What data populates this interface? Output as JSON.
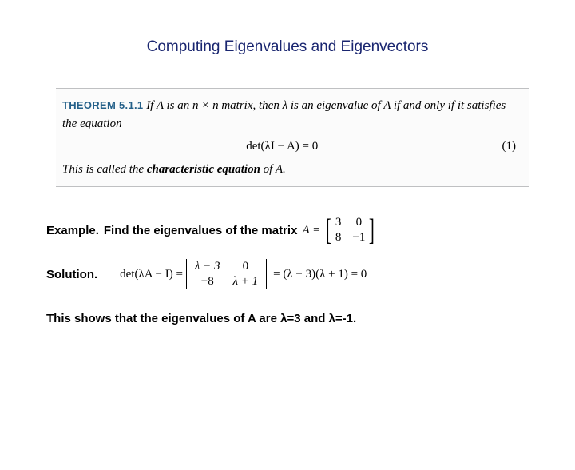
{
  "title": "Computing Eigenvalues and Eigenvectors",
  "theorem": {
    "label": "THEOREM 5.1.1",
    "text_lead": " If A is an n × n matrix, then λ is an eigenvalue of A if and only if it satisfies the equation",
    "equation": "det(λI − A) = 0",
    "eq_num": "(1)",
    "text_trail_plain": "This is called the ",
    "text_trail_bold": "characteristic equation",
    "text_trail_end": " of A."
  },
  "example": {
    "label": "Example.",
    "text": "Find the eigenvalues of the matrix",
    "matrix_lhs": "A =",
    "m": {
      "a11": "3",
      "a12": "0",
      "a21": "8",
      "a22": "−1"
    }
  },
  "solution": {
    "label": "Solution.",
    "det_lhs": "det(λA − I) =",
    "d": {
      "a11": "λ − 3",
      "a12": "0",
      "a21": "−8",
      "a22": "λ + 1"
    },
    "rhs": "= (λ − 3)(λ + 1) = 0"
  },
  "conclusion": "This shows that the eigenvalues of A are λ=3 and λ=-1."
}
